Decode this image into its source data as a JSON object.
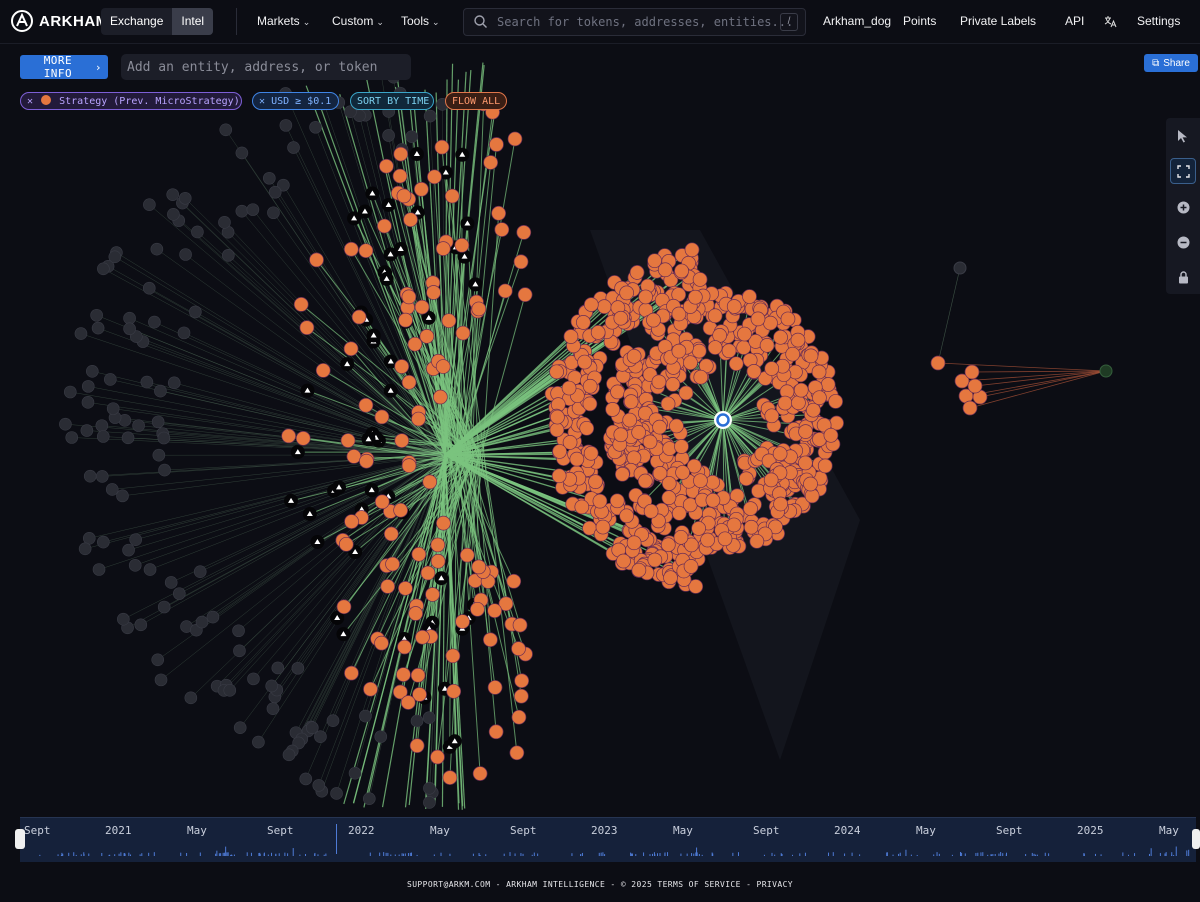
{
  "brand": {
    "name": "ARKHAM"
  },
  "nav": {
    "segments": [
      {
        "label": "Exchange"
      },
      {
        "label": "Intel"
      }
    ],
    "menus": [
      {
        "label": "Markets"
      },
      {
        "label": "Custom"
      },
      {
        "label": "Tools"
      }
    ],
    "search_placeholder": "Search for tokens, addresses, entities...",
    "search_shortcut": "/",
    "right_links": [
      {
        "label": "Arkham_dog"
      },
      {
        "label": "Points"
      },
      {
        "label": "Private Labels"
      },
      {
        "label": "API"
      },
      {
        "label": "Settings"
      }
    ],
    "translate_icon": "translate-icon"
  },
  "toolbar": {
    "more_info_label": "MORE INFO",
    "entity_placeholder": "Add an entity, address, or token",
    "share_label": "Share"
  },
  "filters": {
    "strategy": "Strategy (Prev. MicroStrategy)",
    "usd": "USD ≥ $0.1",
    "sort": "SORT BY TIME",
    "flow": "FLOW ALL"
  },
  "colors": {
    "accent": "#2a6fd6",
    "entity_node": "#e5773f",
    "edge_in": "#7bc47f",
    "edge_out": "#b3563a",
    "background": "#0c0d14"
  },
  "graph_tools": [
    {
      "name": "pointer-icon"
    },
    {
      "name": "fit-screen-icon"
    },
    {
      "name": "zoom-in-icon"
    },
    {
      "name": "zoom-out-icon"
    },
    {
      "name": "lock-icon"
    }
  ],
  "timeline": {
    "labels": [
      "Sept",
      "2021",
      "May",
      "Sept",
      "2022",
      "May",
      "Sept",
      "2023",
      "May",
      "Sept",
      "2024",
      "May",
      "Sept",
      "2025",
      "May"
    ]
  },
  "footer": {
    "text": "SUPPORT@ARKM.COM - ARKHAM INTELLIGENCE - © 2025",
    "terms": "TERMS OF SERVICE",
    "sep": "-",
    "privacy": "PRIVACY"
  }
}
